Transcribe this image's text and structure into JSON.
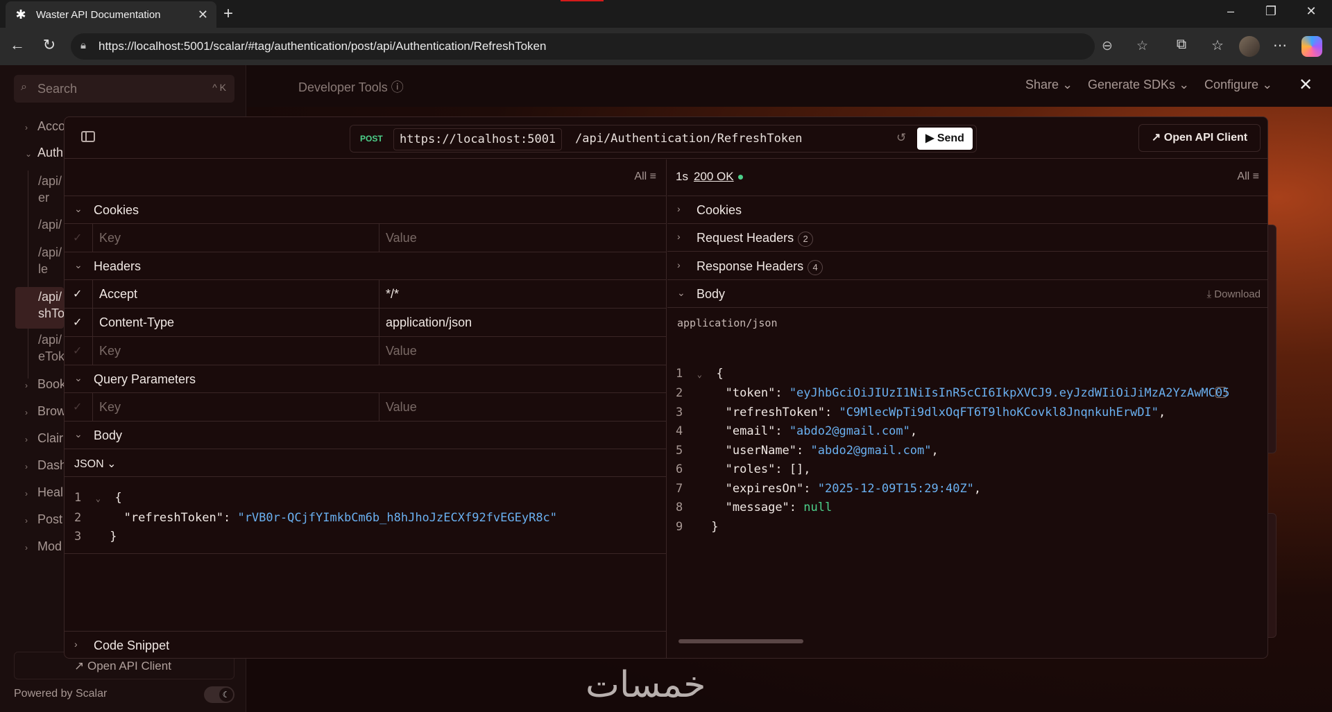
{
  "browser": {
    "tab_title": "Waster API Documentation",
    "url": "https://localhost:5001/scalar/#tag/authentication/post/api/Authentication/RefreshToken"
  },
  "sidebar": {
    "search_placeholder": "Search",
    "search_shortcut": "^ K",
    "items": [
      {
        "label": "Acco",
        "expanded": false
      },
      {
        "label": "Auth",
        "expanded": true
      },
      {
        "label": "Book",
        "expanded": false
      },
      {
        "label": "Brow",
        "expanded": false
      },
      {
        "label": "Clair",
        "expanded": false
      },
      {
        "label": "Dash",
        "expanded": false
      },
      {
        "label": "Heal",
        "expanded": false
      },
      {
        "label": "Post",
        "expanded": false
      },
      {
        "label": "Mod",
        "expanded": false
      }
    ],
    "sub_items": [
      {
        "line1": "/api/",
        "line2": "er"
      },
      {
        "line1": "/api/",
        "line2": ""
      },
      {
        "line1": "/api/",
        "line2": "le"
      },
      {
        "line1": "/api/",
        "line2": "shTo"
      },
      {
        "line1": "/api/",
        "line2": "eTok"
      }
    ],
    "open_client": "Open API Client",
    "powered_by": "Powered by Scalar"
  },
  "topbar": {
    "dev_tools": "Developer Tools",
    "share": "Share",
    "generate_sdks": "Generate SDKs",
    "configure": "Configure"
  },
  "request": {
    "method": "POST",
    "server": "https://localhost:5001",
    "path": "/api/Authentication/RefreshToken",
    "send_label": "Send",
    "open_api_client": "Open API Client",
    "filter": "All",
    "sections": {
      "cookies": "Cookies",
      "headers": "Headers",
      "query": "Query Parameters",
      "body": "Body",
      "code_snippet": "Code Snippet"
    },
    "key_placeholder": "Key",
    "value_placeholder": "Value",
    "headers": [
      {
        "key": "Accept",
        "value": "*/*",
        "enabled": true
      },
      {
        "key": "Content-Type",
        "value": "application/json",
        "enabled": true
      }
    ],
    "body_format": "JSON",
    "body_lines": {
      "l1_num": "1",
      "l2_num": "2",
      "l3_num": "3",
      "open": "{",
      "key": "\"refreshToken\"",
      "value": "\"rVB0r-QCjfYImkbCm6b_h8hJhoJzECXf92fvEGEyR8c\"",
      "close": "}"
    }
  },
  "response": {
    "time": "1s",
    "status": "200 OK",
    "filter": "All",
    "sections": {
      "cookies": "Cookies",
      "request_headers": "Request Headers",
      "request_headers_count": "2",
      "response_headers": "Response Headers",
      "response_headers_count": "4",
      "body": "Body",
      "download": "Download"
    },
    "content_type": "application/json",
    "json": {
      "token_key": "\"token\"",
      "token_val": "\"eyJhbGciOiJIUzI1NiIsInR5cCI6IkpXVCJ9.eyJzdWIiOiJiMzA2YzAwMC05",
      "refresh_key": "\"refreshToken\"",
      "refresh_val": "\"C9MlecWpTi9dlxOqFT6T9lhoKCovkl8JnqnkuhErwDI\"",
      "email_key": "\"email\"",
      "email_val": "\"abdo2@gmail.com\"",
      "user_key": "\"userName\"",
      "user_val": "\"abdo2@gmail.com\"",
      "roles_key": "\"roles\"",
      "roles_val": "[]",
      "expires_key": "\"expiresOn\"",
      "expires_val": "\"2025-12-09T15:29:40Z\"",
      "message_key": "\"message\"",
      "message_val": "null"
    }
  },
  "watermark": "خمسات",
  "colors": {
    "accent_green": "#4cd08a",
    "string_blue": "#6ab0f0",
    "background": "#1a0b0b"
  }
}
